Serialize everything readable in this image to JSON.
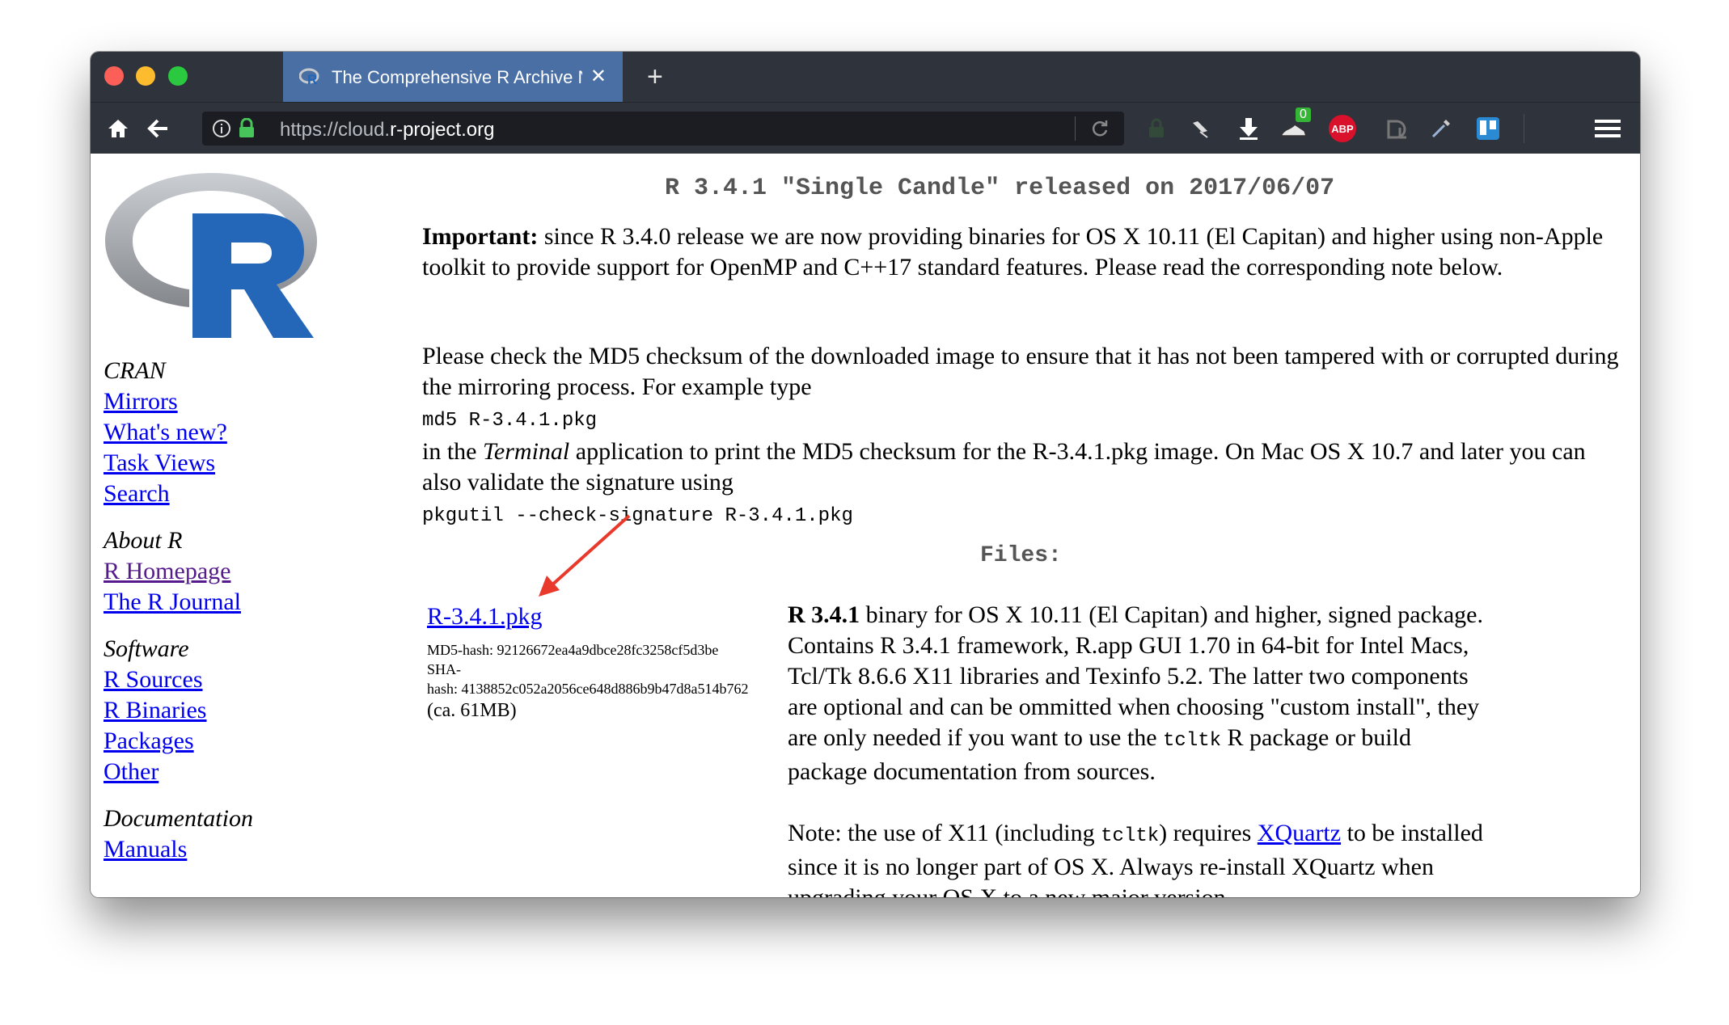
{
  "browser": {
    "tab_title": "The Comprehensive R Archive Network",
    "new_tab_label": "+",
    "url_prefix": "https://cloud.",
    "url_host": "r-project.org",
    "adblock_badge": "ABP",
    "download_count": "0"
  },
  "sidebar": {
    "sections": [
      {
        "heading": "CRAN",
        "links": [
          "Mirrors",
          "What's new?",
          "Task Views",
          "Search"
        ]
      },
      {
        "heading": "About R",
        "links": [
          "R Homepage",
          "The R Journal"
        ]
      },
      {
        "heading": "Software",
        "links": [
          "R Sources",
          "R Binaries",
          "Packages",
          "Other"
        ]
      },
      {
        "heading": "Documentation",
        "links": [
          "Manuals"
        ]
      }
    ]
  },
  "main": {
    "release_title": "R 3.4.1 \"Single Candle\" released on 2017/06/07",
    "important_label": "Important:",
    "important_text": " since R 3.4.0 release we are now providing binaries for OS X 10.11 (El Capitan) and higher using non-Apple toolkit to provide support for OpenMP and C++17 standard features. Please read the corresponding note below.",
    "md5_intro": "Please check the MD5 checksum of the downloaded image to ensure that it has not been tampered with or corrupted during the mirroring process. For example type",
    "md5_cmd": "md5 R-3.4.1.pkg",
    "terminal_pre": "in the ",
    "terminal_word": "Terminal",
    "terminal_post": " application to print the MD5 checksum for the R-3.4.1.pkg image. On Mac OS X 10.7 and later you can also validate the signature using",
    "pkgutil_cmd": "pkgutil --check-signature R-3.4.1.pkg",
    "files_heading": "Files:",
    "pkg_link": "R-3.4.1.pkg",
    "md5_hash": "MD5-hash: 92126672ea4a9dbce28fc3258cf5d3be",
    "sha_label": "SHA-",
    "sha_hash": "hash: 4138852c052a2056ce648d886b9b47d8a514b762",
    "size": "(ca. 61MB)",
    "desc_bold": "R 3.4.1",
    "desc_text": " binary for OS X 10.11 (El Capitan) and higher, signed package. Contains R 3.4.1 framework, R.app GUI 1.70 in 64-bit for Intel Macs, Tcl/Tk 8.6.6 X11 libraries and Texinfo 5.2. The latter two components are optional and can be ommitted when choosing \"custom install\", they are only needed if you want to use the ",
    "desc_tcltk": "tcltk",
    "desc_tail": " R package or build package documentation from sources.",
    "note_pre": "Note: the use of X11 (including ",
    "note_tcltk": "tcltk",
    "note_mid": ") requires ",
    "note_link": "XQuartz",
    "note_post": " to be installed since it is no longer part of OS X. Always re-install XQuartz when upgrading your OS X to a new major version."
  },
  "colors": {
    "chrome": "#2f333b",
    "active_tab": "#4a6fa5",
    "link": "#0000ee",
    "visited": "#551a8b",
    "annotation_arrow": "#e8392b"
  }
}
